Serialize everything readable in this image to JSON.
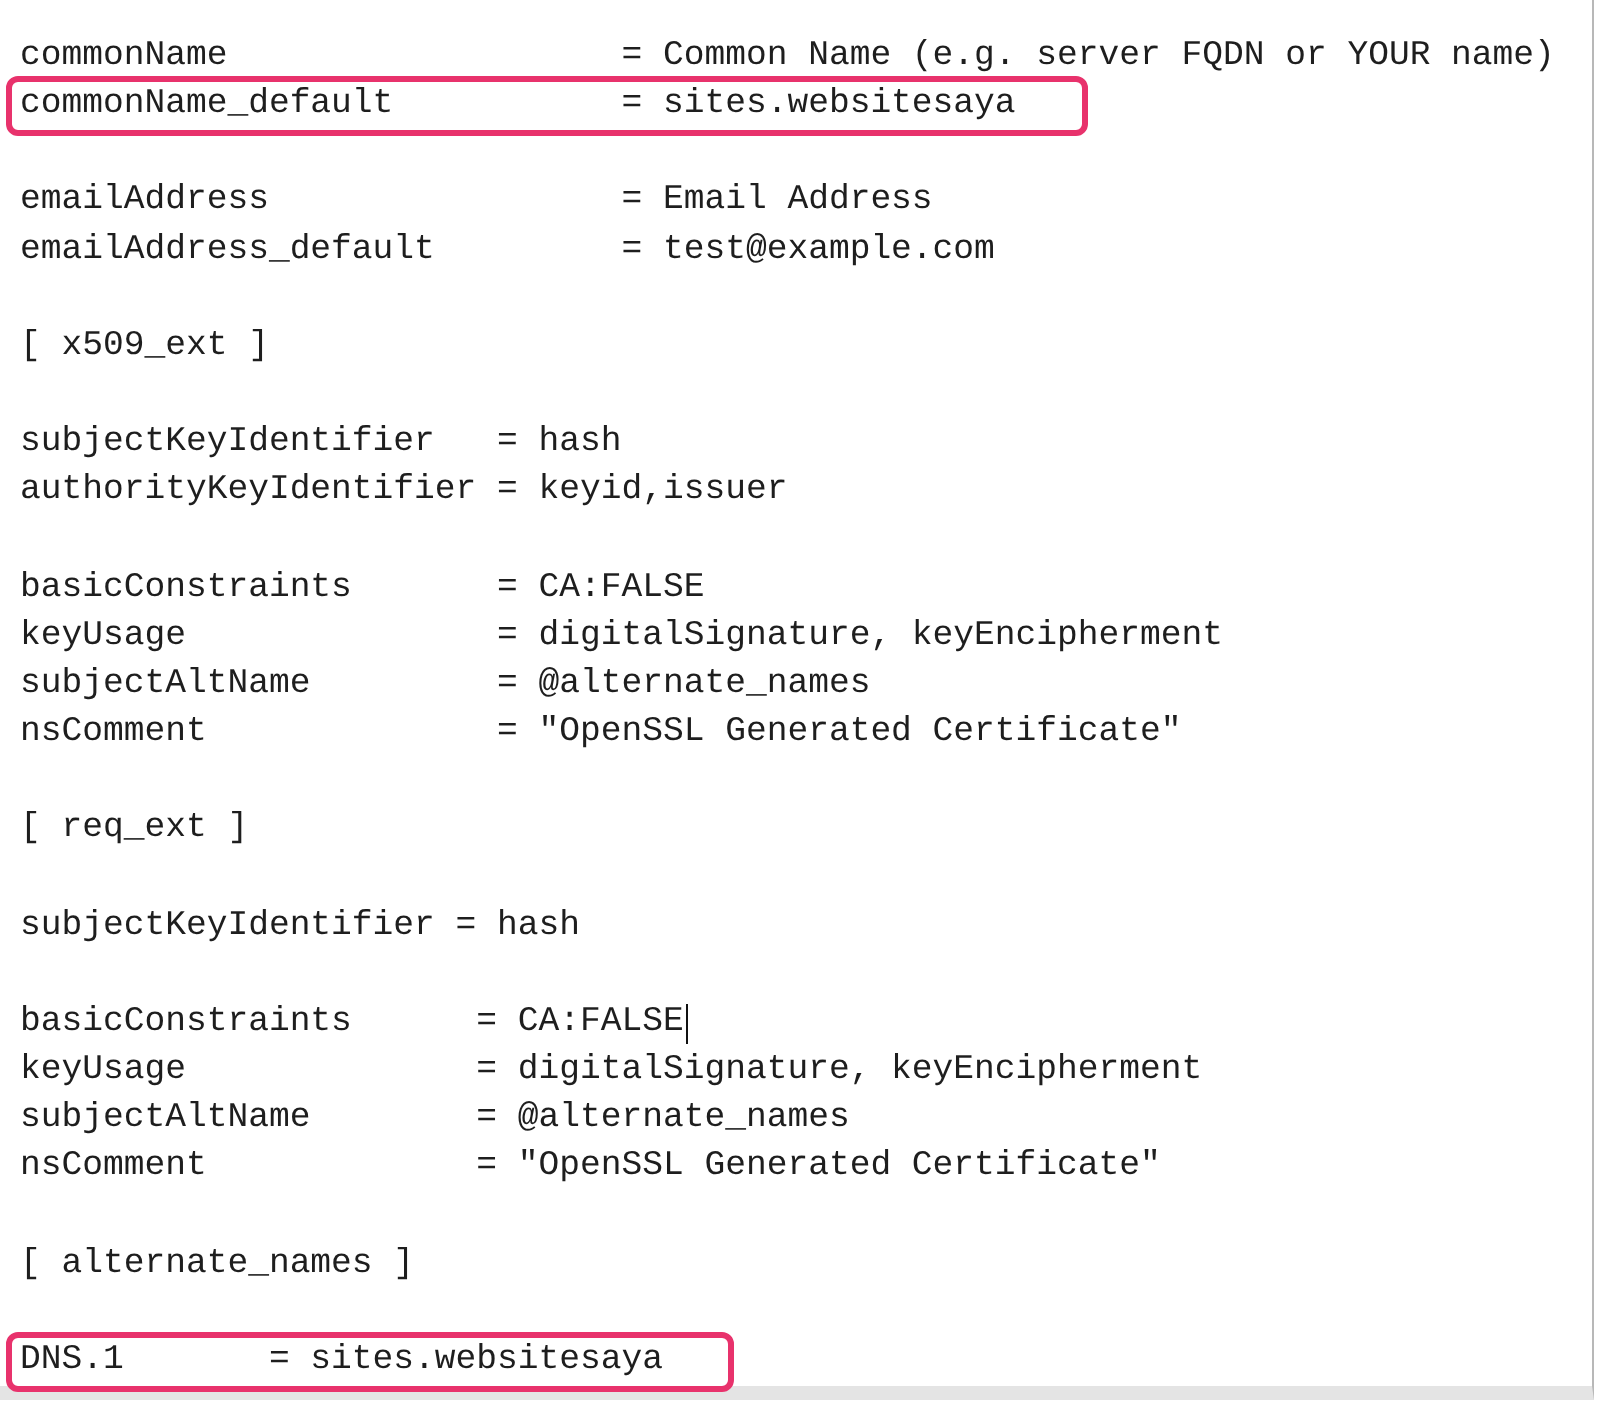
{
  "editor": {
    "lines": [
      {
        "kind": "text",
        "text": "commonName                   = Common Name (e.g. server FQDN or YOUR name)",
        "highlighted": false
      },
      {
        "kind": "text",
        "text": "commonName_default           = sites.websitesaya",
        "highlighted": true
      },
      {
        "kind": "blank"
      },
      {
        "kind": "text",
        "text": "emailAddress                 = Email Address",
        "highlighted": false
      },
      {
        "kind": "text",
        "text": "emailAddress_default         = test@example.com",
        "highlighted": false
      },
      {
        "kind": "blank"
      },
      {
        "kind": "text",
        "text": "[ x509_ext ]",
        "highlighted": false
      },
      {
        "kind": "blank"
      },
      {
        "kind": "text",
        "text": "subjectKeyIdentifier   = hash",
        "highlighted": false
      },
      {
        "kind": "text",
        "text": "authorityKeyIdentifier = keyid,issuer",
        "highlighted": false
      },
      {
        "kind": "blank"
      },
      {
        "kind": "text",
        "text": "basicConstraints       = CA:FALSE",
        "highlighted": false
      },
      {
        "kind": "text",
        "text": "keyUsage               = digitalSignature, keyEncipherment",
        "highlighted": false
      },
      {
        "kind": "text",
        "text": "subjectAltName         = @alternate_names",
        "highlighted": false
      },
      {
        "kind": "text",
        "text": "nsComment              = \"OpenSSL Generated Certificate\"",
        "highlighted": false
      },
      {
        "kind": "blank"
      },
      {
        "kind": "text",
        "text": "[ req_ext ]",
        "highlighted": false
      },
      {
        "kind": "blank"
      },
      {
        "kind": "text",
        "text": "subjectKeyIdentifier = hash",
        "highlighted": false
      },
      {
        "kind": "blank"
      },
      {
        "kind": "text",
        "text": "basicConstraints      = CA:FALSE",
        "highlighted": false,
        "caret": true
      },
      {
        "kind": "text",
        "text": "keyUsage              = digitalSignature, keyEncipherment",
        "highlighted": false
      },
      {
        "kind": "text",
        "text": "subjectAltName        = @alternate_names",
        "highlighted": false
      },
      {
        "kind": "text",
        "text": "nsComment             = \"OpenSSL Generated Certificate\"",
        "highlighted": false
      },
      {
        "kind": "blank"
      },
      {
        "kind": "text",
        "text": "[ alternate_names ]",
        "highlighted": false
      },
      {
        "kind": "blank"
      },
      {
        "kind": "text",
        "text": "DNS.1       = sites.websitesaya",
        "highlighted": true
      }
    ]
  }
}
